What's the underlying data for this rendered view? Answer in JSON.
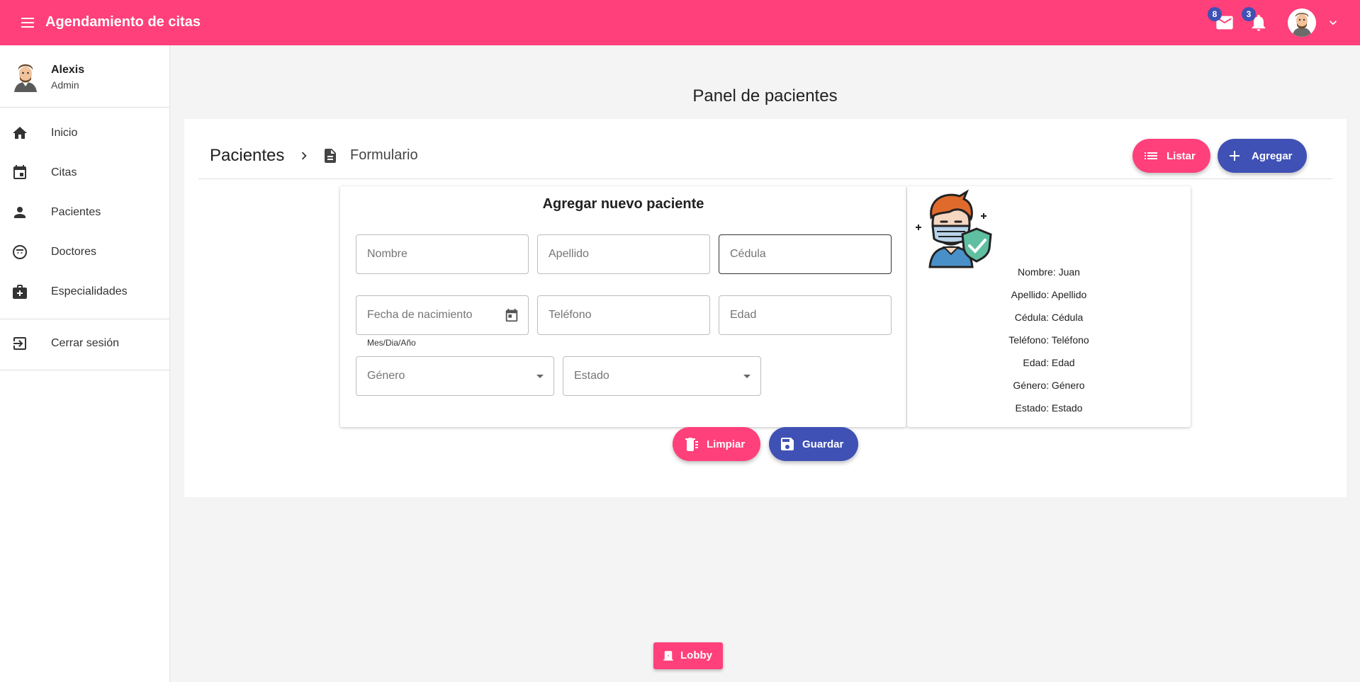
{
  "app": {
    "title": "Agendamiento de citas",
    "mail_count": "8",
    "notification_count": "3"
  },
  "user": {
    "name": "Alexis",
    "role": "Admin"
  },
  "sidebar": {
    "items": [
      {
        "label": "Inicio",
        "icon": "home-icon"
      },
      {
        "label": "Citas",
        "icon": "calendar-icon"
      },
      {
        "label": "Pacientes",
        "icon": "person-icon"
      },
      {
        "label": "Doctores",
        "icon": "doctor-icon"
      },
      {
        "label": "Especialidades",
        "icon": "medical-bag-icon"
      }
    ],
    "logout_label": "Cerrar sesión"
  },
  "main": {
    "title": "Panel de pacientes",
    "breadcrumb_root": "Pacientes",
    "breadcrumb_page": "Formulario",
    "list_button": "Listar",
    "add_button": "Agregar"
  },
  "form": {
    "title": "Agregar nuevo paciente",
    "nombre_placeholder": "Nombre",
    "apellido_placeholder": "Apellido",
    "cedula_placeholder": "Cédula",
    "fecha_placeholder": "Fecha de nacimiento",
    "fecha_hint": "Mes/Dia/Año",
    "telefono_placeholder": "Teléfono",
    "edad_placeholder": "Edad",
    "genero_placeholder": "Género",
    "estado_placeholder": "Estado",
    "clear_button": "Limpiar",
    "save_button": "Guardar"
  },
  "preview": {
    "lines": [
      "Nombre: Juan",
      "Apellido: Apellido",
      "Cédula: Cédula",
      "Teléfono: Teléfono",
      "Edad: Edad",
      "Género: Género",
      "Estado: Estado"
    ]
  },
  "footer": {
    "lobby_button": "Lobby"
  },
  "colors": {
    "primary": "#ff407b",
    "accent": "#3f51b5",
    "background": "#f4f4f4"
  }
}
